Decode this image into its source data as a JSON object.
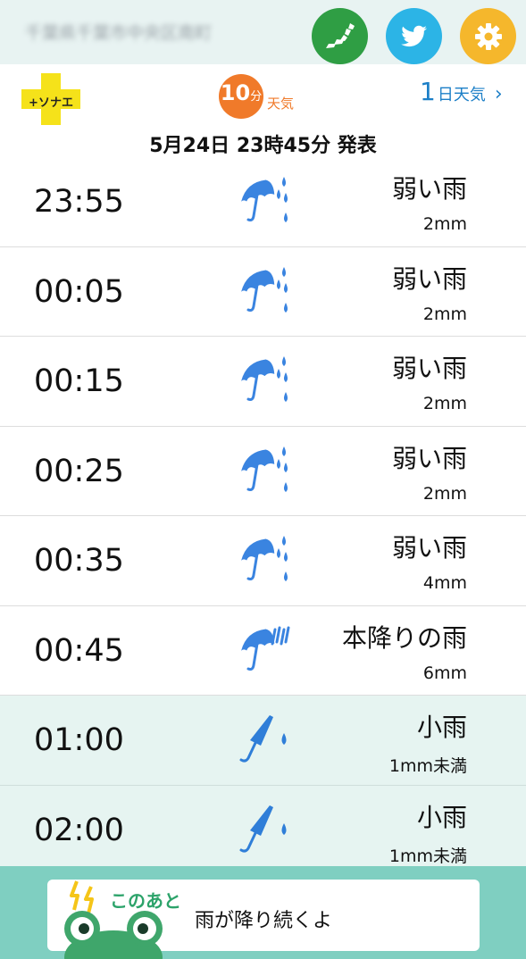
{
  "header": {
    "location": "千葉県千葉市中央区南町",
    "icons": {
      "map": "japan-map-icon",
      "twitter": "twitter-bird-icon",
      "settings": "gear-icon"
    },
    "colors": {
      "map": "#2f9e44",
      "twitter": "#2cb4e6",
      "settings": "#f5b72c",
      "bar": "#e8f3f2"
    }
  },
  "subheader": {
    "sonae_logo": "+ソナエ",
    "tenmin_num": "10",
    "tenmin_unit": "分",
    "tenmin_label": "天気",
    "oneday_num": "1",
    "oneday_text": "日天気",
    "oneday_chevron": "›",
    "announce": "5月24日 23時45分 発表"
  },
  "rows": [
    {
      "time": "23:55",
      "weather": "弱い雨",
      "amount": "2mm",
      "icon": "umbrella-light-rain-icon"
    },
    {
      "time": "00:05",
      "weather": "弱い雨",
      "amount": "2mm",
      "icon": "umbrella-light-rain-icon"
    },
    {
      "time": "00:15",
      "weather": "弱い雨",
      "amount": "2mm",
      "icon": "umbrella-light-rain-icon"
    },
    {
      "time": "00:25",
      "weather": "弱い雨",
      "amount": "2mm",
      "icon": "umbrella-light-rain-icon"
    },
    {
      "time": "00:35",
      "weather": "弱い雨",
      "amount": "4mm",
      "icon": "umbrella-light-rain-icon"
    },
    {
      "time": "00:45",
      "weather": "本降りの雨",
      "amount": "6mm",
      "icon": "umbrella-heavy-rain-icon"
    },
    {
      "time": "01:00",
      "weather": "小雨",
      "amount": "1mm未満",
      "icon": "umbrella-drizzle-icon"
    },
    {
      "time": "02:00",
      "weather": "小雨",
      "amount": "1mm未満",
      "icon": "umbrella-drizzle-icon"
    }
  ],
  "bottom": {
    "label": "このあと",
    "message": "雨が降り続くよ",
    "icons": {
      "mascot": "frog-icon",
      "bolt": "lightning-icon"
    }
  },
  "colors": {
    "accent_orange": "#f07a2a",
    "link_blue": "#1c7fc7",
    "future_row": "#e6f4f1",
    "banner": "#7fcfc1",
    "umbrella": "#3a84e0"
  }
}
